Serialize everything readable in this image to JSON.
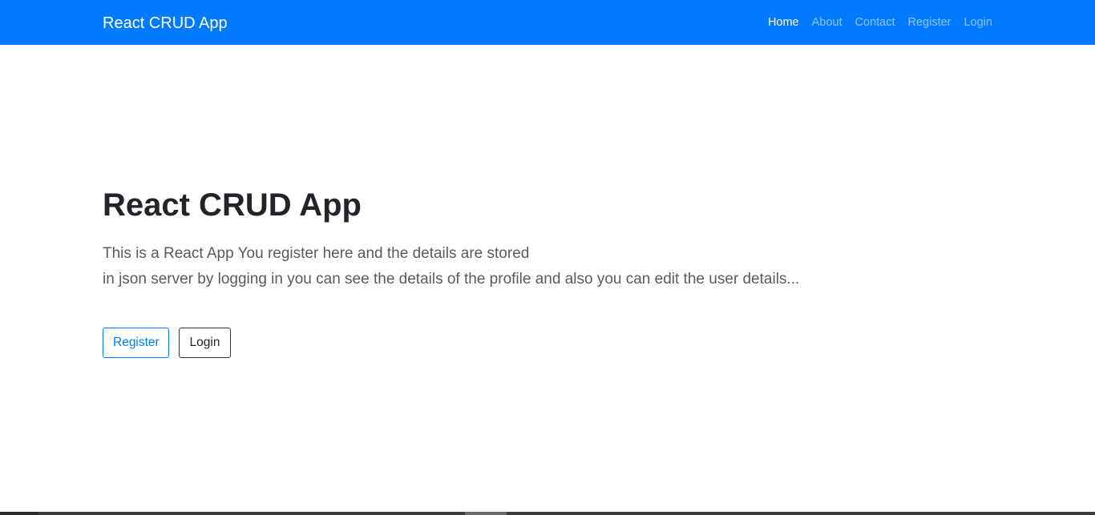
{
  "navbar": {
    "brand": "React CRUD App",
    "links": [
      {
        "label": "Home",
        "active": true
      },
      {
        "label": "About",
        "active": false
      },
      {
        "label": "Contact",
        "active": false
      },
      {
        "label": "Register",
        "active": false
      },
      {
        "label": "Login",
        "active": false
      }
    ]
  },
  "hero": {
    "title": "React CRUD App",
    "lead_line1": "This is a React App You register here and the details are stored",
    "lead_line2": "in json server by logging in you can see the details of the profile and also you can edit the user details...",
    "register_button": "Register",
    "login_button": "Login"
  },
  "colors": {
    "primary": "#007bff",
    "dark": "#343a40",
    "text": "#212529"
  }
}
